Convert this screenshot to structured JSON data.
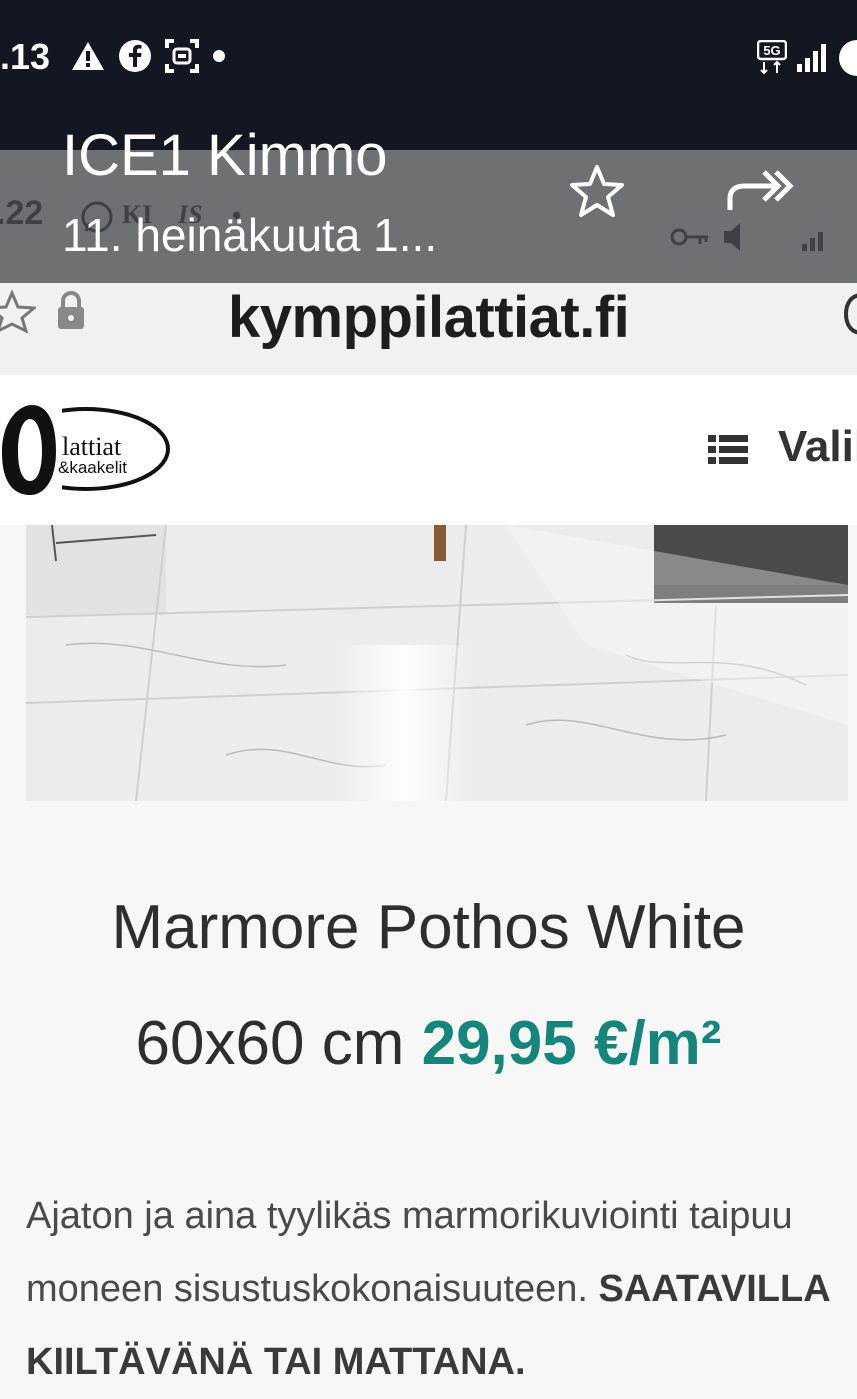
{
  "status_bar": {
    "time": ".13"
  },
  "notification": {
    "bg_time": ".22",
    "bg_k_text": "KI",
    "bg_s_text": "IS",
    "bg_dot": "•",
    "title": "ICE1 Kimmo",
    "subtitle": "11. heinäkuuta 1..."
  },
  "browser": {
    "url": "kymppilattiat.fi"
  },
  "site": {
    "logo_line1": "lattiat",
    "logo_line2": "&kaakelit",
    "menu_label": "Valik"
  },
  "product": {
    "name": "Marmore Pothos White",
    "size": "60x60 cm",
    "price": "29,95 €/m²",
    "description": "Ajaton ja aina tyylikäs marmorikuviointi taipuu moneen sisustuskokonaisuuteen.",
    "availability": "SAATAVILLA KIILTÄVÄNÄ TAI MATTANA."
  }
}
